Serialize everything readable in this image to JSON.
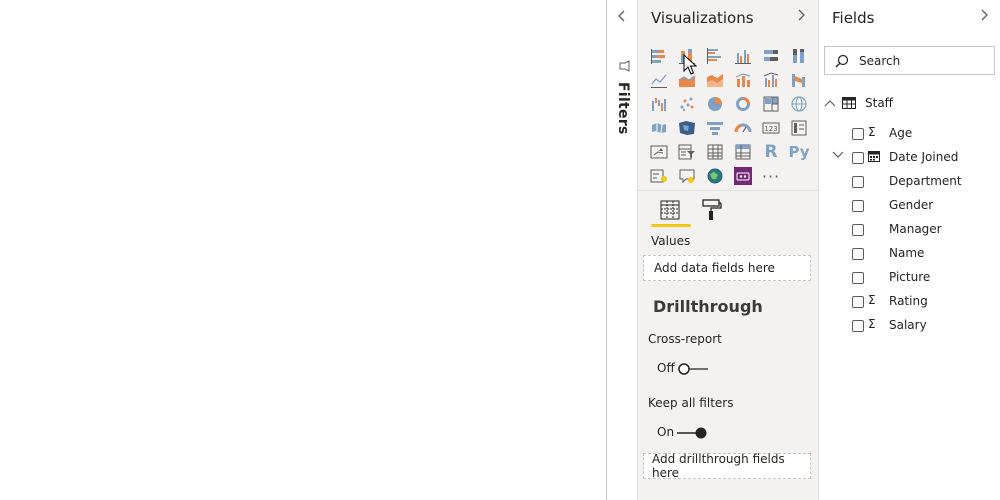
{
  "filters": {
    "title": "Filters",
    "collapse_icon": "chevron-left-icon",
    "icon": "filter-funnel-icon"
  },
  "visualizations": {
    "title": "Visualizations",
    "expand_icon": "chevron-right-icon",
    "icons": [
      "stacked-bar-chart-icon",
      "stacked-column-chart-icon",
      "clustered-bar-chart-icon",
      "clustered-column-chart-icon",
      "100-stacked-bar-chart-icon",
      "100-stacked-column-chart-icon",
      "line-chart-icon",
      "area-chart-icon",
      "stacked-area-chart-icon",
      "line-and-stacked-column-chart-icon",
      "line-and-clustered-column-chart-icon",
      "ribbon-chart-icon",
      "waterfall-chart-icon",
      "scatter-chart-icon",
      "pie-chart-icon",
      "donut-chart-icon",
      "treemap-icon",
      "map-icon",
      "filled-map-icon",
      "shape-map-icon",
      "funnel-icon",
      "gauge-icon",
      "card-icon",
      "multi-row-card-icon",
      "kpi-icon",
      "slicer-icon",
      "table-icon",
      "matrix-icon",
      "r-script-visual-icon",
      "python-visual-icon",
      "key-influencers-icon",
      "qa-icon",
      "arcgis-map-icon",
      "power-apps-icon",
      "more-visuals-icon"
    ],
    "r_glyph": "R",
    "py_glyph": "Py",
    "more_glyph": "···",
    "tabs": {
      "fields_icon": "fields-tab-icon",
      "format_icon": "format-paint-roller-icon",
      "accent": "#f2c811"
    },
    "values_label": "Values",
    "values_dropzone": "Add data fields here",
    "drillthrough_title": "Drillthrough",
    "cross_report_label": "Cross-report",
    "cross_report_state": "Off",
    "keep_filters_label": "Keep all filters",
    "keep_filters_state": "On",
    "drillthrough_dropzone": "Add drillthrough fields here"
  },
  "fields": {
    "title": "Fields",
    "expand_icon": "chevron-right-icon",
    "search_placeholder": "Search",
    "table": {
      "name": "Staff",
      "icon": "table-icon",
      "expander_icon": "chevron-up-icon"
    },
    "items": [
      {
        "name": "Age",
        "type": "Σ"
      },
      {
        "name": "Date Joined",
        "type": "calendar",
        "expander": "chevron-down-icon"
      },
      {
        "name": "Department",
        "type": ""
      },
      {
        "name": "Gender",
        "type": ""
      },
      {
        "name": "Manager",
        "type": ""
      },
      {
        "name": "Name",
        "type": ""
      },
      {
        "name": "Picture",
        "type": ""
      },
      {
        "name": "Rating",
        "type": "Σ"
      },
      {
        "name": "Salary",
        "type": "Σ"
      }
    ]
  },
  "colors": {
    "pane_background": "#f3f2f1",
    "icon_blue": "#7fa1c5",
    "icon_orange": "#e8884a",
    "power_apps_purple": "#742774"
  }
}
